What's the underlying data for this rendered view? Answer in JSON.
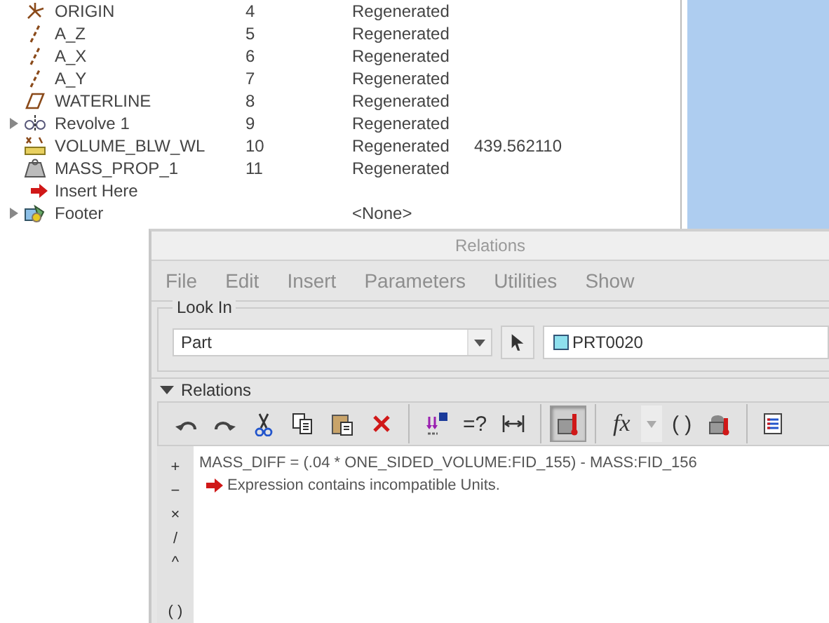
{
  "model_tree": {
    "rows": [
      {
        "kind": "csys",
        "name": "ORIGIN",
        "id": "4",
        "status": "Regenerated"
      },
      {
        "kind": "axis",
        "name": "A_Z",
        "id": "5",
        "status": "Regenerated"
      },
      {
        "kind": "axis",
        "name": "A_X",
        "id": "6",
        "status": "Regenerated"
      },
      {
        "kind": "axis",
        "name": "A_Y",
        "id": "7",
        "status": "Regenerated"
      },
      {
        "kind": "plane",
        "name": "WATERLINE",
        "id": "8",
        "status": "Regenerated"
      },
      {
        "kind": "revolve",
        "name": "Revolve 1",
        "id": "9",
        "status": "Regenerated",
        "expanded": false
      },
      {
        "kind": "analysis",
        "name": "VOLUME_BLW_WL",
        "id": "10",
        "status": "Regenerated",
        "value": "439.562110"
      },
      {
        "kind": "mass",
        "name": "MASS_PROP_1",
        "id": "11",
        "status": "Regenerated"
      },
      {
        "kind": "insert",
        "name": "Insert Here"
      },
      {
        "kind": "footer",
        "name": "Footer",
        "status": "<None>",
        "expanded": false
      }
    ]
  },
  "dialog": {
    "title": "Relations",
    "menu": [
      {
        "label": "File",
        "disabled": true
      },
      {
        "label": "Edit",
        "disabled": true
      },
      {
        "label": "Insert",
        "disabled": true
      },
      {
        "label": "Parameters",
        "disabled": true
      },
      {
        "label": "Utilities",
        "disabled": true
      },
      {
        "label": "Show",
        "disabled": true
      }
    ],
    "look_in": {
      "label": "Look In",
      "type": "Part",
      "object": "PRT0020"
    },
    "section": {
      "label": "Relations",
      "expanded": true
    },
    "toolbar": [
      {
        "kind": "undo"
      },
      {
        "kind": "redo"
      },
      {
        "kind": "cut"
      },
      {
        "kind": "copy"
      },
      {
        "kind": "paste"
      },
      {
        "kind": "delete"
      },
      {
        "kind": "sep"
      },
      {
        "kind": "sort"
      },
      {
        "kind": "text",
        "label": "=?"
      },
      {
        "kind": "measure"
      },
      {
        "kind": "sep"
      },
      {
        "kind": "units",
        "pressed": true
      },
      {
        "kind": "sep"
      },
      {
        "kind": "italic",
        "label": "fx"
      },
      {
        "kind": "dropdown"
      },
      {
        "kind": "text",
        "label": "( )"
      },
      {
        "kind": "param"
      },
      {
        "kind": "sep"
      },
      {
        "kind": "list"
      }
    ],
    "operators": [
      "+",
      "−",
      "×",
      "/",
      "^",
      "( )"
    ],
    "editor": {
      "lines": [
        {
          "kind": "code",
          "text": "MASS_DIFF = (.04 * ONE_SIDED_VOLUME:FID_155) - MASS:FID_156"
        },
        {
          "kind": "error",
          "text": "Expression contains incompatible Units."
        }
      ]
    }
  }
}
